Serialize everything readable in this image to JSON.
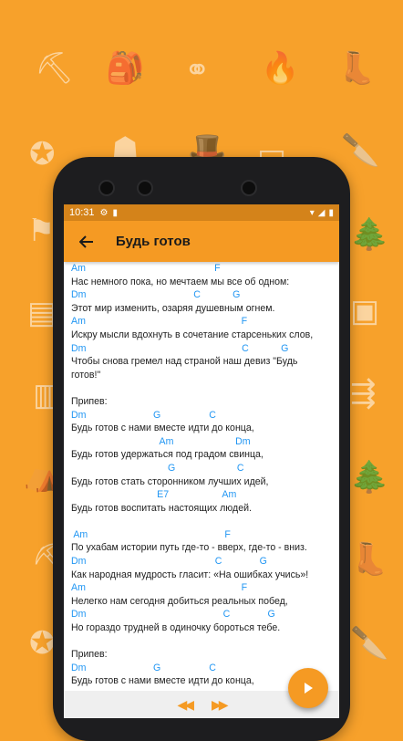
{
  "status_bar": {
    "time": "10:31"
  },
  "app_bar": {
    "title": "Будь готов"
  },
  "background_icons": [
    "axe-icon",
    "backpack-icon",
    "binoculars-icon",
    "campfire-icon",
    "boot-icon",
    "compass-icon",
    "lantern-icon",
    "hat-icon",
    "radio-icon",
    "knife-icon",
    "flag-icon",
    "trees-icon",
    "stove-icon",
    "photo-icon",
    "matches-icon",
    "signpost-icon",
    "tent-icon",
    "trees-icon",
    "axe-icon",
    "boot-icon",
    "compass-icon",
    "knife-icon"
  ],
  "song_lines": [
    {
      "type": "chord",
      "text": "Am                                                F"
    },
    {
      "type": "lyric",
      "text": "Нас немного пока, но мечтаем мы все об одном:"
    },
    {
      "type": "chord",
      "text": "Dm                                        C            G"
    },
    {
      "type": "lyric",
      "text": "Этот мир изменить, озаряя душевным огнем."
    },
    {
      "type": "chord",
      "text": "Am                                                          F"
    },
    {
      "type": "lyric",
      "text": "Искру мысли вдохнуть в сочетание старсеньких слов,"
    },
    {
      "type": "chord",
      "text": "Dm                                                          C            G"
    },
    {
      "type": "lyric",
      "text": "Чтобы снова гремел над страной наш девиз \"Будь"
    },
    {
      "type": "lyric",
      "text": "готов!\""
    },
    {
      "type": "blank",
      "text": ""
    },
    {
      "type": "lyric",
      "text": "Припев:"
    },
    {
      "type": "chord",
      "text": "Dm                         G                  C"
    },
    {
      "type": "lyric",
      "text": "Будь готов с нами вместе идти до конца,"
    },
    {
      "type": "chord",
      "text": "                                 Am                       Dm"
    },
    {
      "type": "lyric",
      "text": "Будь готов удержаться под градом свинца,"
    },
    {
      "type": "chord",
      "text": "                                    G                       C"
    },
    {
      "type": "lyric",
      "text": "Будь готов стать сторонником лучших идей,"
    },
    {
      "type": "chord",
      "text": "                                E7                    Am"
    },
    {
      "type": "lyric",
      "text": "Будь готов воспитать настоящих людей."
    },
    {
      "type": "blank",
      "text": ""
    },
    {
      "type": "chord",
      "text": " Am                                                   F"
    },
    {
      "type": "lyric",
      "text": "По ухабам истории путь где-то - вверх, где-то - вниз."
    },
    {
      "type": "chord",
      "text": "Dm                                                C              G"
    },
    {
      "type": "lyric",
      "text": "Как народная мудрость гласит: «На ошибках учись»!"
    },
    {
      "type": "chord",
      "text": "Am                                                          F"
    },
    {
      "type": "lyric",
      "text": "Нелегко нам сегодня добиться реальных побед,"
    },
    {
      "type": "chord",
      "text": "Dm                                                   C              G"
    },
    {
      "type": "lyric",
      "text": "Но гораздо трудней в одиночку бороться тебе."
    },
    {
      "type": "blank",
      "text": ""
    },
    {
      "type": "lyric",
      "text": "Припев:"
    },
    {
      "type": "chord",
      "text": "Dm                         G                  C"
    },
    {
      "type": "lyric",
      "text": "Будь готов с нами вместе идти до конца,"
    }
  ],
  "nav": {
    "prev_icon": "rewind-icon",
    "next_icon": "fast-forward-icon"
  },
  "fab": {
    "icon": "play-icon"
  },
  "colors": {
    "accent": "#f59a23",
    "chord": "#2196f3",
    "background": "#f7a12b"
  }
}
